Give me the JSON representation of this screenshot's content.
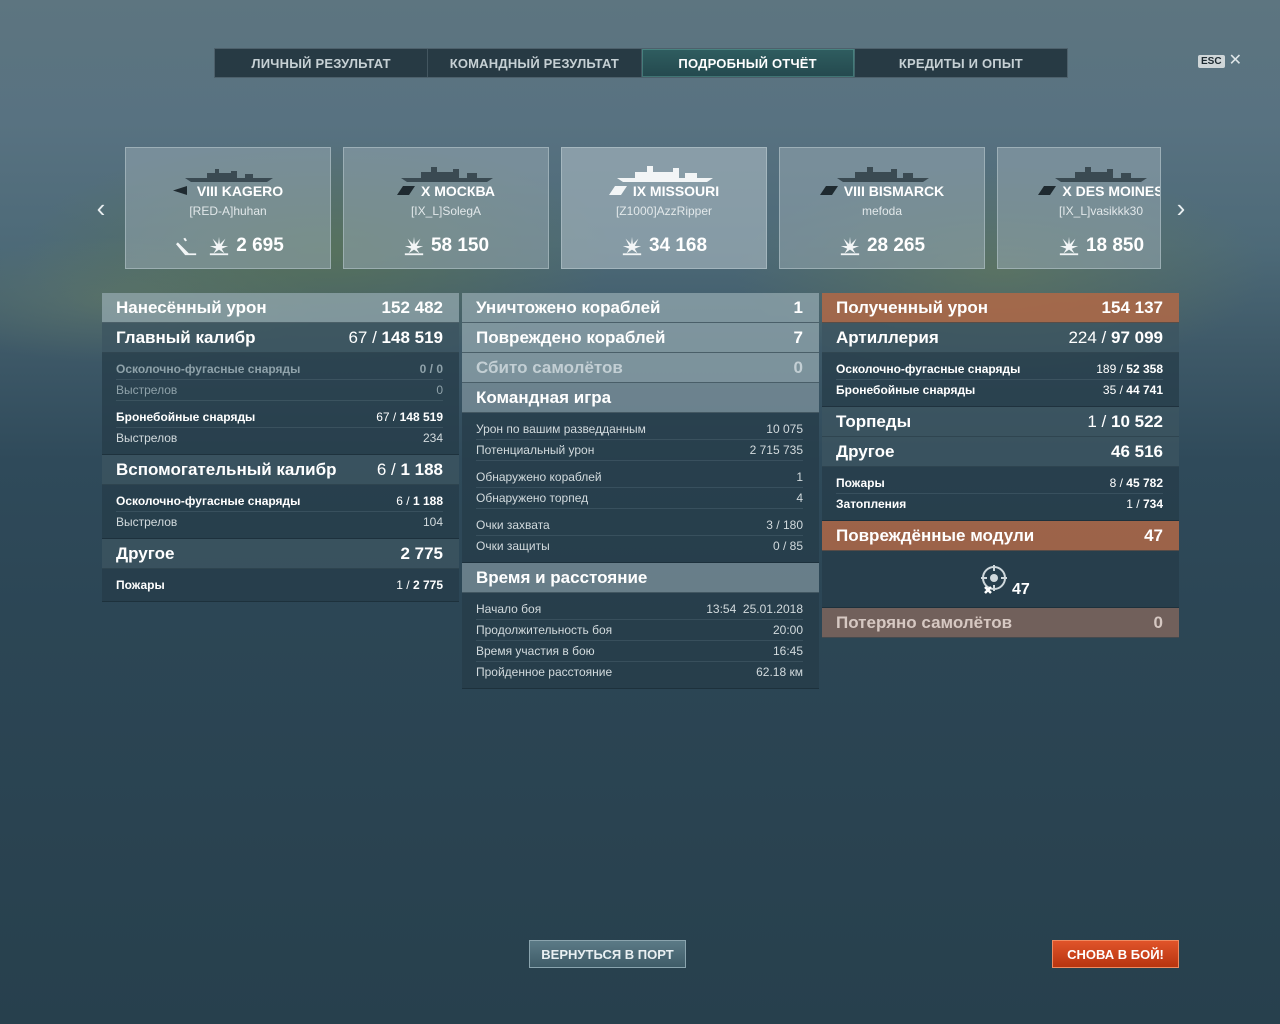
{
  "tabs": [
    {
      "label": "ЛИЧНЫЙ РЕЗУЛЬТАТ"
    },
    {
      "label": "КОМАНДНЫЙ РЕЗУЛЬТАТ"
    },
    {
      "label": "ПОДРОБНЫЙ ОТЧЁТ"
    },
    {
      "label": "КРЕДИТЫ И ОПЫТ"
    }
  ],
  "active_tab": 2,
  "esc_label": "ESC",
  "close_glyph": "✕",
  "nav": {
    "prev": "‹",
    "next": "›"
  },
  "ships": [
    {
      "title": "VIII KAGERO",
      "player": "[RED-A]huhan",
      "damage": "2 695",
      "class_icon": "destroyer-icon",
      "extra_icon": "sunk-icon"
    },
    {
      "title": "X МОСКВА",
      "player": "[IX_L]SolegA",
      "damage": "58 150",
      "class_icon": "cruiser-icon"
    },
    {
      "title": "IX MISSOURI",
      "player": "[Z1000]AzzRipper",
      "damage": "34 168",
      "class_icon": "battleship-icon"
    },
    {
      "title": "VIII BISMARCK",
      "player": "mefoda",
      "damage": "28 265",
      "class_icon": "battleship-icon"
    },
    {
      "title": "X DES MOINES",
      "player": "[IX_L]vasikkk30",
      "damage": "18 850",
      "class_icon": "cruiser-icon"
    }
  ],
  "left": {
    "dealt": {
      "label": "Нанесённый урон",
      "value": "152 482"
    },
    "main": {
      "label": "Главный калибр",
      "hits": "67",
      "value": "148 519"
    },
    "main_he": {
      "label": "Осколочно-фугасные снаряды",
      "hits": "0",
      "value": "0"
    },
    "main_he_shots": {
      "label": "Выстрелов",
      "value": "0"
    },
    "main_ap": {
      "label": "Бронебойные снаряды",
      "hits": "67",
      "value": "148 519"
    },
    "main_ap_shots": {
      "label": "Выстрелов",
      "value": "234"
    },
    "secondary": {
      "label": "Вспомогательный калибр",
      "hits": "6",
      "value": "1 188"
    },
    "sec_he": {
      "label": "Осколочно-фугасные снаряды",
      "hits": "6",
      "value": "1 188"
    },
    "sec_shots": {
      "label": "Выстрелов",
      "value": "104"
    },
    "other": {
      "label": "Другое",
      "value": "2 775"
    },
    "fires": {
      "label": "Пожары",
      "hits": "1",
      "value": "2 775"
    }
  },
  "middle": {
    "destroyed": {
      "label": "Уничтожено кораблей",
      "value": "1"
    },
    "damaged": {
      "label": "Повреждено кораблей",
      "value": "7"
    },
    "planes": {
      "label": "Сбито самолётов",
      "value": "0"
    },
    "team": {
      "label": "Командная игра"
    },
    "spotting_damage": {
      "label": "Урон по вашим разведданным",
      "value": "10 075"
    },
    "potential": {
      "label": "Потенциальный урон",
      "value": "2 715 735"
    },
    "spotted_ships": {
      "label": "Обнаружено кораблей",
      "value": "1"
    },
    "spotted_torps": {
      "label": "Обнаружено торпед",
      "value": "4"
    },
    "capture": {
      "label": "Очки захвата",
      "value": "3 / 180"
    },
    "defense": {
      "label": "Очки защиты",
      "value": "0 / 85"
    },
    "time": {
      "label": "Время и расстояние"
    },
    "start": {
      "label": "Начало боя",
      "value": "13:54  25.01.2018"
    },
    "duration": {
      "label": "Продолжительность боя",
      "value": "20:00"
    },
    "participation": {
      "label": "Время участия в бою",
      "value": "16:45"
    },
    "distance": {
      "label": "Пройденное расстояние",
      "value": "62.18 км"
    }
  },
  "right": {
    "received": {
      "label": "Полученный урон",
      "value": "154 137"
    },
    "artillery": {
      "label": "Артиллерия",
      "hits": "224",
      "value": "97 099"
    },
    "art_he": {
      "label": "Осколочно-фугасные снаряды",
      "hits": "189",
      "value": "52 358"
    },
    "art_ap": {
      "label": "Бронебойные снаряды",
      "hits": "35",
      "value": "44 741"
    },
    "torpedoes": {
      "label": "Торпеды",
      "hits": "1",
      "value": "10 522"
    },
    "other": {
      "label": "Другое",
      "value": "46 516"
    },
    "fires": {
      "label": "Пожары",
      "hits": "8",
      "value": "45 782"
    },
    "flooding": {
      "label": "Затопления",
      "hits": "1",
      "value": "734"
    },
    "modules": {
      "label": "Повреждённые модули",
      "value": "47",
      "count": "47"
    },
    "planes_lost": {
      "label": "Потеряно самолётов",
      "value": "0"
    }
  },
  "buttons": {
    "port": "ВЕРНУТЬСЯ В ПОРТ",
    "again": "СНОВА В БОЙ!"
  },
  "colors": {
    "accent_orange": "#c4501f",
    "tab_active": "#2a5256",
    "header_orange": "#b0684a"
  }
}
